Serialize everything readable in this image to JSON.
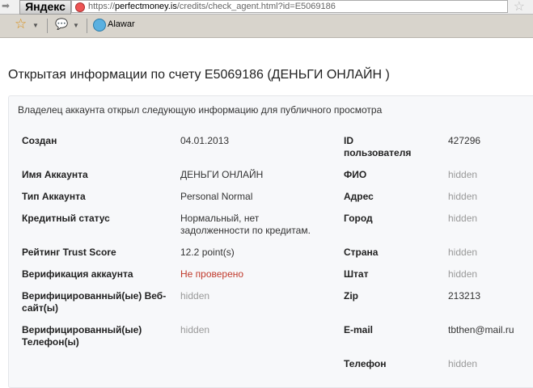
{
  "browser": {
    "yandex_label": "Яндекс",
    "url_domain": "perfectmoney.is",
    "url_prefix": "https://",
    "url_rest": "/credits/check_agent.html?id=E5069186",
    "bookmark": "Alawar"
  },
  "page": {
    "title": "Открытая информации по счету E5069186 (ДЕНЬГИ ОНЛАЙН )",
    "intro": "Владелец аккаунта открыл следующую информацию для публичного просмотра"
  },
  "left": [
    {
      "label": "Создан",
      "value": "04.01.2013"
    },
    {
      "label": "Имя Аккаунта",
      "value": "ДЕНЬГИ ОНЛАЙН"
    },
    {
      "label": "Тип Аккаунта",
      "value": "Personal Normal"
    },
    {
      "label": "Кредитный статус",
      "value": "Нормальный, нет задолженности по кредитам."
    },
    {
      "label": "Рейтинг Trust Score",
      "value": "12.2 point(s)"
    },
    {
      "label": "Верификация аккаунта",
      "value": "Не проверено"
    },
    {
      "label": "Верифицированный(ые) Веб-сайт(ы)",
      "value": "hidden"
    },
    {
      "label": "Верифицированный(ые) Телефон(ы)",
      "value": "hidden"
    }
  ],
  "right": [
    {
      "label": "ID пользователя",
      "value": "427296"
    },
    {
      "label": "ФИО",
      "value": "hidden"
    },
    {
      "label": "Адрес",
      "value": "hidden"
    },
    {
      "label": "Город",
      "value": "hidden"
    },
    {
      "label": "Страна",
      "value": "hidden"
    },
    {
      "label": "Штат",
      "value": "hidden"
    },
    {
      "label": "Zip",
      "value": "213213"
    },
    {
      "label": "E-mail",
      "value": "tbthen@mail.ru"
    },
    {
      "label": "Телефон",
      "value": "hidden"
    }
  ]
}
